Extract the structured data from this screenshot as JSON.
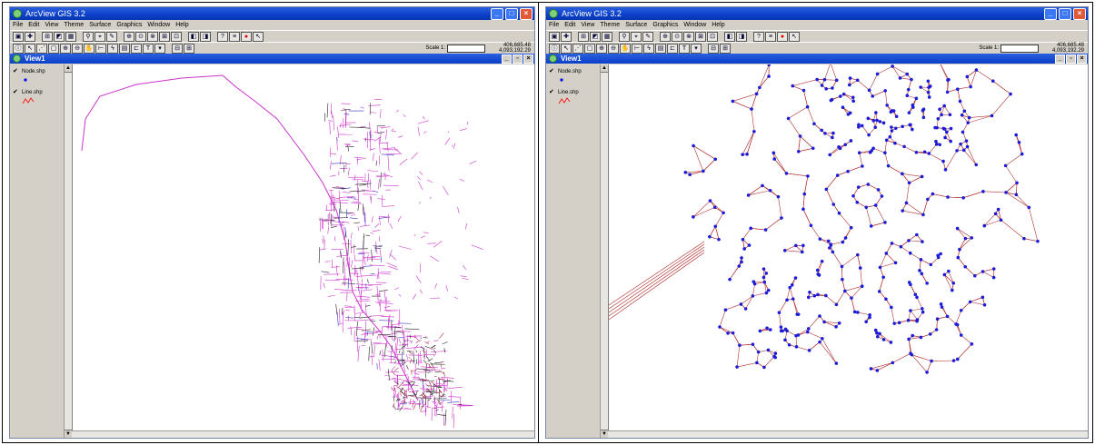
{
  "windows": [
    {
      "app_title": "ArcView GIS 3.2",
      "menus": [
        "File",
        "Edit",
        "View",
        "Theme",
        "Surface",
        "Graphics",
        "Window",
        "Help"
      ],
      "scale_label": "Scale 1:",
      "scale_value": "",
      "coord_x": "406,685.48",
      "coord_y": "4,093,192.29",
      "view_title": "View1",
      "layers": [
        {
          "name": "Node.shp",
          "symbol": "point",
          "color": "#0000ff"
        },
        {
          "name": "Line.shp",
          "symbol": "line",
          "color": "#ff0000"
        }
      ],
      "map_style": "coastal-network",
      "line_color": "#cc33cc"
    },
    {
      "app_title": "ArcView GIS 3.2",
      "menus": [
        "File",
        "Edit",
        "View",
        "Theme",
        "Surface",
        "Graphics",
        "Window",
        "Help"
      ],
      "scale_label": "Scale 1:",
      "scale_value": "",
      "coord_x": "406,685.48",
      "coord_y": "4,093,192.29",
      "view_title": "View1",
      "layers": [
        {
          "name": "Node.shp",
          "symbol": "point",
          "color": "#0000ff"
        },
        {
          "name": "Line.shp",
          "symbol": "line",
          "color": "#ff0000"
        }
      ],
      "map_style": "node-network",
      "node_color": "#1c1cd8",
      "edge_color": "#b03030"
    }
  ]
}
